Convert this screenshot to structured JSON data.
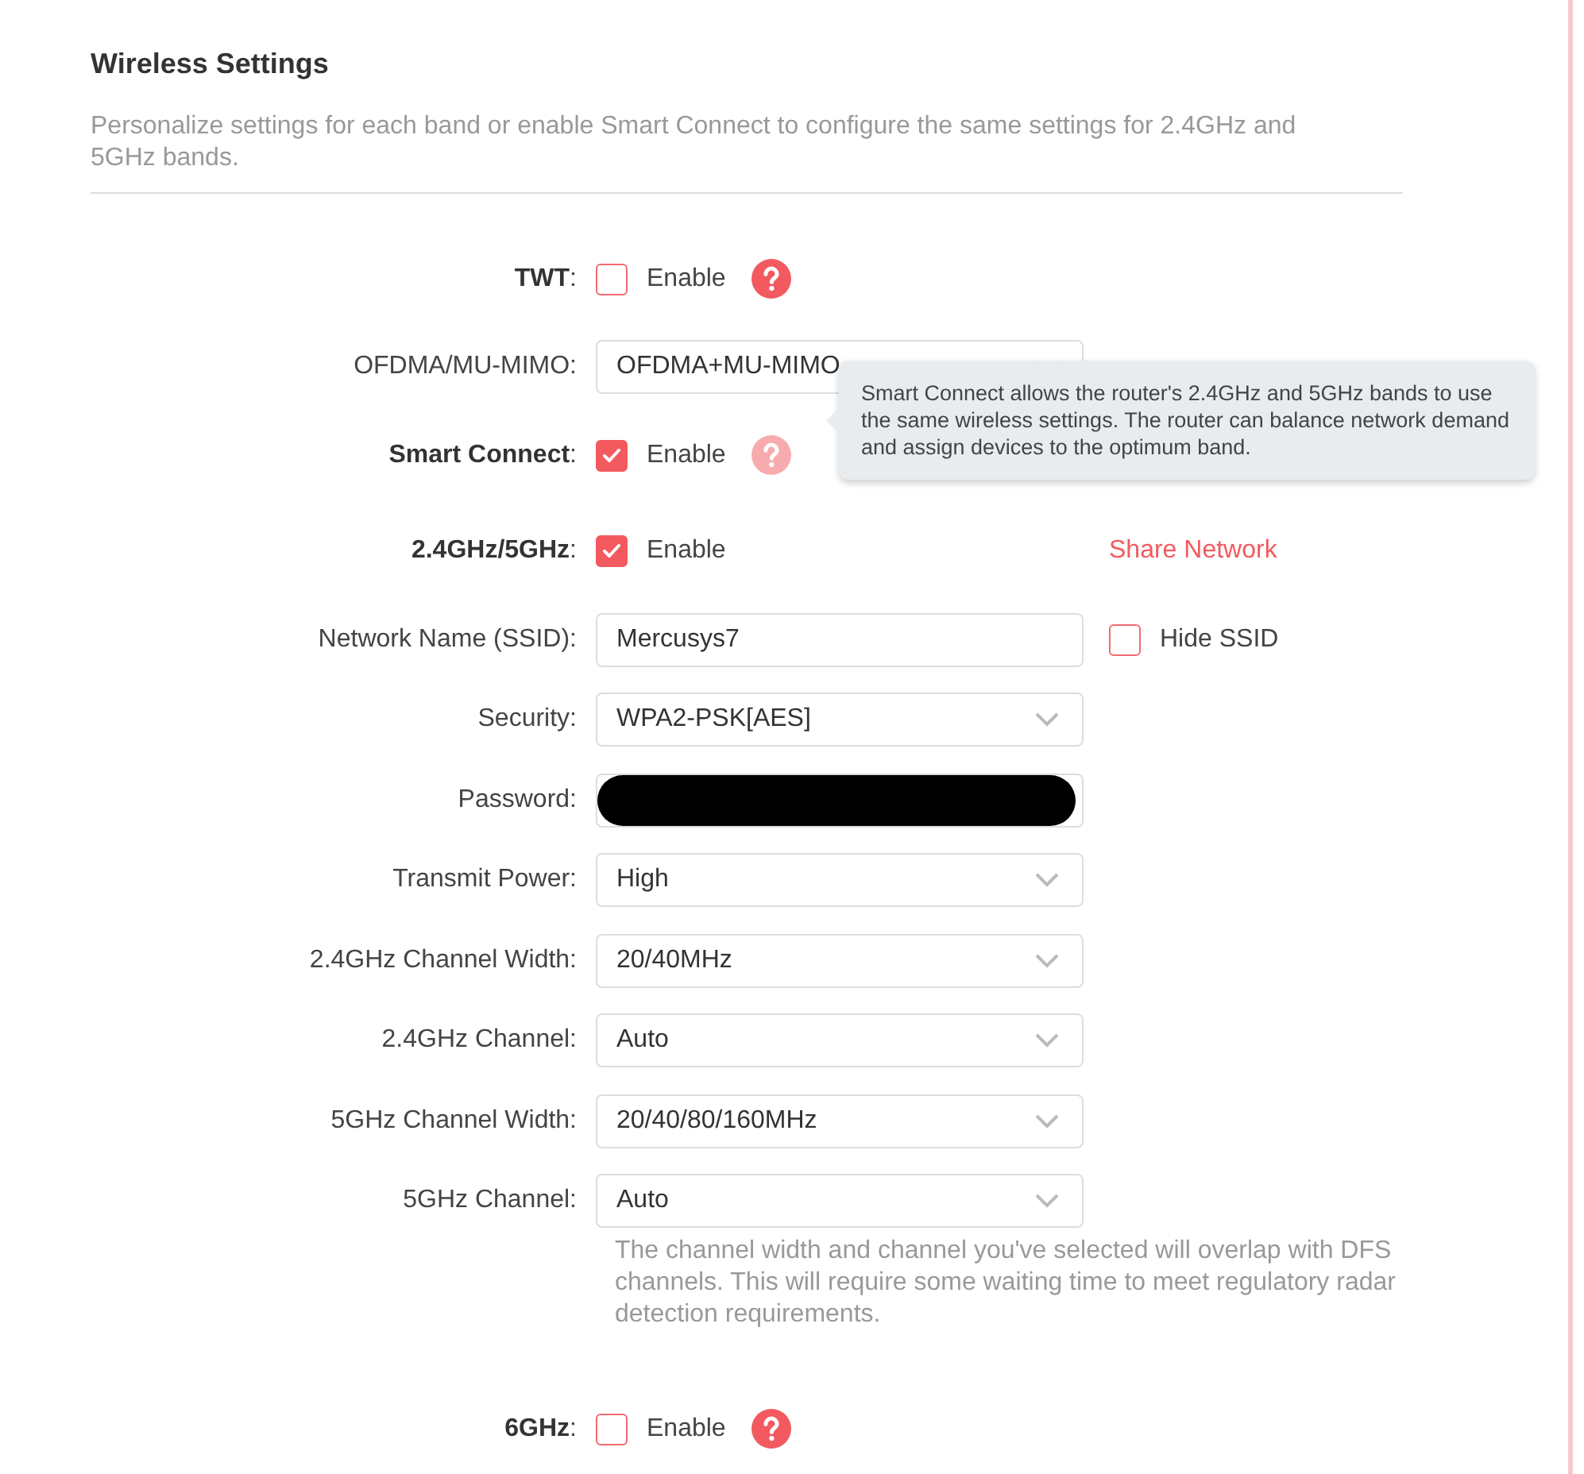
{
  "section": {
    "title": "Wireless Settings",
    "description": "Personalize settings for each band or enable Smart Connect to configure the same settings for 2.4GHz and 5GHz bands."
  },
  "rows": [
    {
      "kind": "checkbox",
      "label": "**TWT**:",
      "option": "Enable",
      "checked": false,
      "help": true
    },
    {
      "kind": "select",
      "label": "OFDMA/MU-MIMO:",
      "value": "OFDMA+MU-MIMO"
    },
    {
      "kind": "checkbox",
      "label": "**Smart Connect**:",
      "option": "Enable",
      "checked": true,
      "help": true,
      "tooltip": "Smart Connect allows the router's 2.4GHz and 5GHz bands to use the same wireless settings. The router can balance network demand and assign devices to the optimum band."
    },
    {
      "kind": "checkbox",
      "label": "**2.4GHz/5GHz**:",
      "option": "Enable",
      "checked": true,
      "link": "Share Network"
    },
    {
      "kind": "text",
      "label": "Network Name (SSID):",
      "value": "Mercusys7",
      "extra_checkbox": {
        "label": "Hide SSID",
        "checked": false
      }
    },
    {
      "kind": "select",
      "label": "Security:",
      "value": "WPA2-PSK[AES]"
    },
    {
      "kind": "password",
      "label": "Password:",
      "redacted": true
    },
    {
      "kind": "select",
      "label": "Transmit Power:",
      "value": "High"
    },
    {
      "kind": "select",
      "label": "2.4GHz Channel Width:",
      "value": "20/40MHz"
    },
    {
      "kind": "select",
      "label": "2.4GHz Channel:",
      "value": "Auto"
    },
    {
      "kind": "select",
      "label": "5GHz Channel Width:",
      "value": "20/40/80/160MHz"
    },
    {
      "kind": "select",
      "label": "5GHz Channel:",
      "value": "Auto",
      "note": "The channel width and channel you've selected will overlap with DFS channels. This will require some waiting time to meet regulatory radar detection requirements."
    },
    {
      "kind": "checkbox",
      "label": "**6GHz**:",
      "option": "Enable",
      "checked": false,
      "help": true
    }
  ]
}
